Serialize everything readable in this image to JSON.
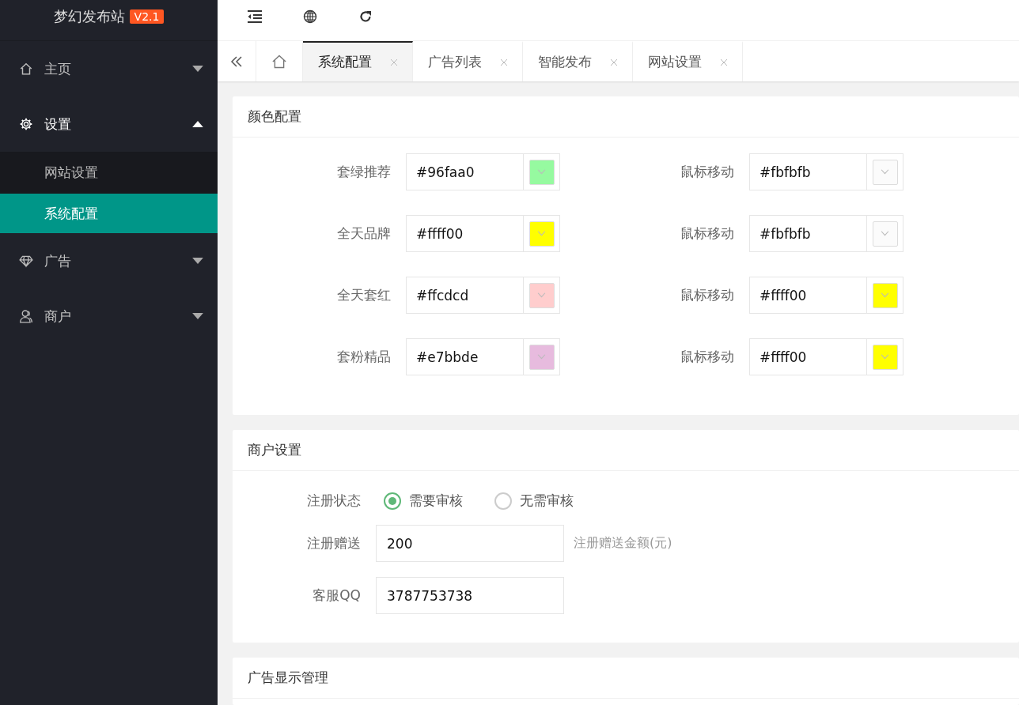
{
  "logo": {
    "title": "梦幻发布站",
    "version": "V2.1"
  },
  "sidebar": {
    "items": [
      {
        "label": "主页",
        "kind": "house",
        "expanded": false
      },
      {
        "label": "设置",
        "kind": "gear",
        "expanded": true,
        "children": [
          {
            "label": "网站设置",
            "selected": false
          },
          {
            "label": "系统配置",
            "selected": true
          }
        ]
      },
      {
        "label": "广告",
        "kind": "diamond",
        "expanded": false
      },
      {
        "label": "商户",
        "kind": "person",
        "expanded": false
      }
    ]
  },
  "tabs": [
    {
      "label": "系统配置",
      "selected": true
    },
    {
      "label": "广告列表",
      "selected": false
    },
    {
      "label": "智能发布",
      "selected": false
    },
    {
      "label": "网站设置",
      "selected": false
    }
  ],
  "color_config": {
    "title": "颜色配置",
    "items": [
      {
        "label": "套绿推荐",
        "value": "#96faa0",
        "color": "#96faa0"
      },
      {
        "label": "鼠标移动",
        "value": "#fbfbfb",
        "color": "#fbfbfb"
      },
      {
        "label": "全天品牌",
        "value": "#ffff00",
        "color": "#ffff00"
      },
      {
        "label": "鼠标移动",
        "value": "#fbfbfb",
        "color": "#fbfbfb"
      },
      {
        "label": "全天套红",
        "value": "#ffcdcd",
        "color": "#ffcdcd"
      },
      {
        "label": "鼠标移动",
        "value": "#ffff00",
        "color": "#ffff00"
      },
      {
        "label": "套粉精品",
        "value": "#e7bbde",
        "color": "#e7bbde"
      },
      {
        "label": "鼠标移动",
        "value": "#ffff00",
        "color": "#ffff00"
      }
    ]
  },
  "merchant_settings": {
    "title": "商户设置",
    "fields": [
      {
        "kind": "radio",
        "label": "注册状态",
        "options": [
          {
            "label": "需要审核",
            "selected": true
          },
          {
            "label": "无需审核",
            "selected": false
          }
        ]
      },
      {
        "kind": "input",
        "label": "注册赠送",
        "value": "200",
        "hint": "注册赠送金额(元)"
      },
      {
        "kind": "input",
        "label": "客服QQ",
        "value": "3787753738"
      }
    ]
  },
  "ad_display": {
    "title": "广告显示管理"
  }
}
